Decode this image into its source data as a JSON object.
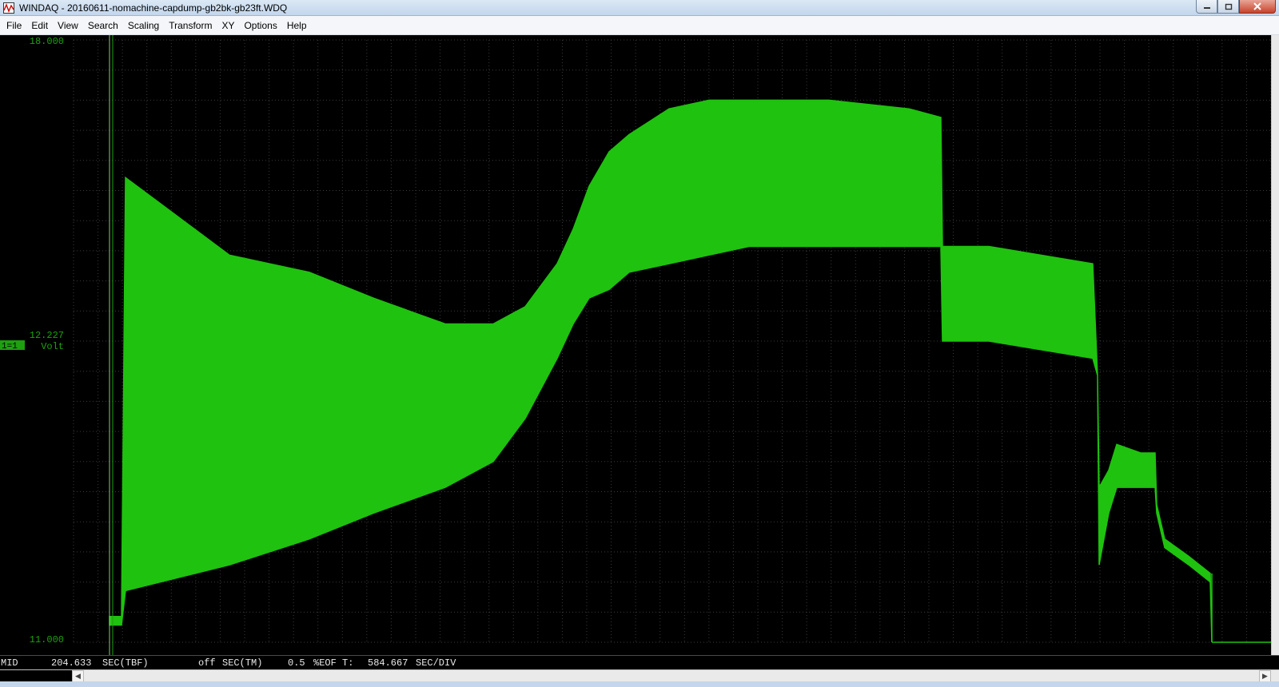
{
  "window": {
    "title": "WINDAQ - 20160611-nomachine-capdump-gb2bk-gb23ft.WDQ",
    "controls": [
      "minimize-icon",
      "maximize-icon",
      "close-icon"
    ]
  },
  "menu": [
    "File",
    "Edit",
    "View",
    "Search",
    "Scaling",
    "Transform",
    "XY",
    "Options",
    "Help"
  ],
  "channel": {
    "top_label": "18.000",
    "mid_label": "12.227",
    "bottom_label": "11.000",
    "id_label": "1=1",
    "unit": "Volt",
    "color": "#1fc20f"
  },
  "status": {
    "mode": "MID",
    "time_value": "204.633",
    "time_unit": "SEC(TBF)",
    "tm_value": "off",
    "tm_unit": "SEC(TM)",
    "eof_value": "0.5",
    "eof_unit": "%EOF T:",
    "div_value": "584.667",
    "div_unit": "SEC/DIV"
  },
  "chart_data": {
    "type": "area",
    "ylim": [
      11.0,
      18.0
    ],
    "grid": true,
    "ytick_labels": [
      "18.000",
      "12.227",
      "11.000"
    ],
    "x_unit": "SEC",
    "x": [
      0,
      15,
      20,
      150,
      250,
      330,
      420,
      480,
      520,
      560,
      580,
      600,
      625,
      650,
      700,
      750,
      800,
      900,
      1000,
      1040,
      1042,
      1100,
      1230,
      1236,
      1238,
      1250,
      1260,
      1290,
      1308,
      1310,
      1320,
      1350,
      1377,
      1379
    ],
    "upper": [
      11.3,
      11.3,
      16.4,
      15.5,
      15.3,
      15.0,
      14.7,
      14.7,
      14.9,
      15.4,
      15.8,
      16.3,
      16.7,
      16.9,
      17.2,
      17.3,
      17.3,
      17.3,
      17.2,
      17.1,
      15.6,
      15.6,
      15.4,
      14.1,
      12.8,
      13.0,
      13.3,
      13.2,
      13.2,
      12.6,
      12.2,
      12.0,
      11.8,
      11.0
    ],
    "lower": [
      11.2,
      11.2,
      11.6,
      11.9,
      12.2,
      12.5,
      12.8,
      13.1,
      13.6,
      14.3,
      14.7,
      15.0,
      15.1,
      15.3,
      15.4,
      15.5,
      15.6,
      15.6,
      15.6,
      15.6,
      14.5,
      14.5,
      14.3,
      14.1,
      11.9,
      12.5,
      12.8,
      12.8,
      12.8,
      12.5,
      12.1,
      11.9,
      11.7,
      11.0
    ]
  }
}
